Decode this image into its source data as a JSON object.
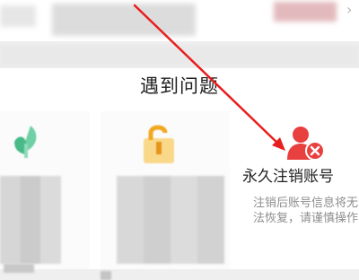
{
  "section": {
    "title": "遇到问题"
  },
  "delete_account": {
    "title": "永久注销账号",
    "description": "注销后账号信息将无法恢复，请谨慎操作"
  },
  "icons": {
    "top_chevron": "chevron-right-icon",
    "card1": "leaf-icon",
    "card2": "lock-icon",
    "card3": "person-remove-icon"
  },
  "colors": {
    "accent_red": "#e8403f",
    "arrow_red": "#e81e1e",
    "leaf_green": "#5fc79a",
    "lock_orange": "#f2b62d",
    "text_dark": "#222222",
    "text_gray": "#8e8e8e"
  }
}
